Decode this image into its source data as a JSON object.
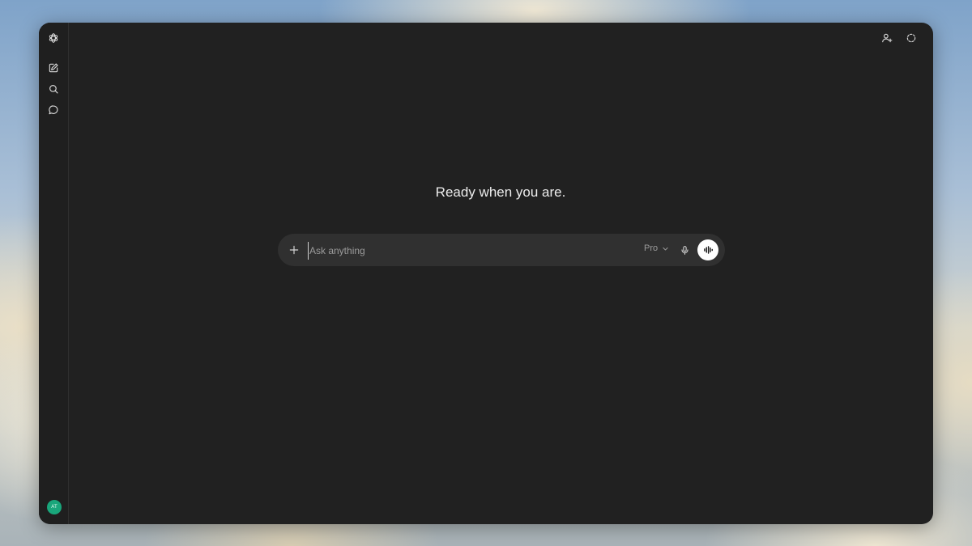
{
  "sidebar": {
    "icons": [
      "openai-logo-icon",
      "new-chat-icon",
      "search-icon",
      "chats-icon"
    ],
    "avatar_initials": "AT",
    "avatar_color": "#19a67b"
  },
  "header": {
    "icons": [
      "add-person-icon",
      "temporary-chat-icon"
    ]
  },
  "main": {
    "headline": "Ready when you are."
  },
  "composer": {
    "placeholder": "Ask anything",
    "value": "",
    "model_label": "Pro"
  },
  "colors": {
    "app_background": "#212121",
    "composer_background": "#303030",
    "text_primary": "#ececec",
    "text_muted": "#9b9b9b"
  }
}
